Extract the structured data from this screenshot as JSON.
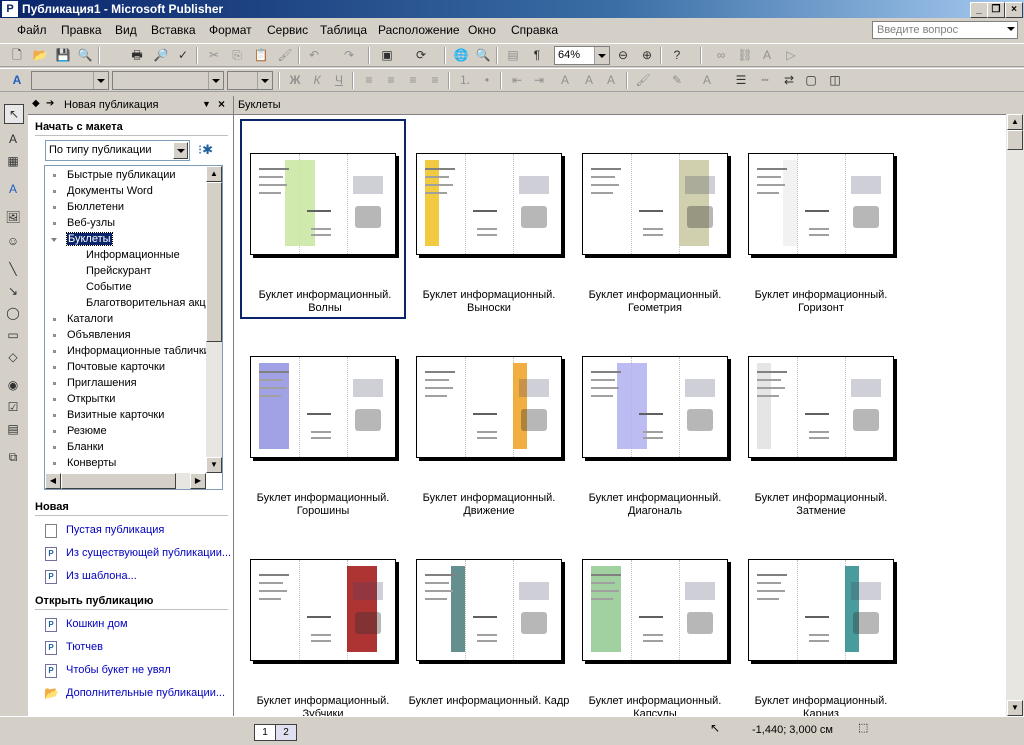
{
  "window": {
    "title": "Публикация1 - Microsoft Publisher",
    "app_icon": "publisher-icon"
  },
  "menu": [
    "Файл",
    "Правка",
    "Вид",
    "Вставка",
    "Формат",
    "Сервис",
    "Таблица",
    "Расположение",
    "Окно",
    "Справка"
  ],
  "ask_question": {
    "placeholder": "Введите вопрос"
  },
  "standard_toolbar": {
    "zoom": "64%"
  },
  "task_pane": {
    "title": "Новая публикация",
    "start_from_layout": "Начать с макета",
    "type_select": "По типу публикации",
    "tree": [
      {
        "label": "Быстрые публикации",
        "level": 0
      },
      {
        "label": "Документы Word",
        "level": 0
      },
      {
        "label": "Бюллетени",
        "level": 0
      },
      {
        "label": "Веб-узлы",
        "level": 0
      },
      {
        "label": "Буклеты",
        "level": 0,
        "expanded": true,
        "selected": true
      },
      {
        "label": "Информационные",
        "level": 1
      },
      {
        "label": "Прейскурант",
        "level": 1
      },
      {
        "label": "Событие",
        "level": 1
      },
      {
        "label": "Благотворительная акц",
        "level": 1
      },
      {
        "label": "Каталоги",
        "level": 0
      },
      {
        "label": "Объявления",
        "level": 0
      },
      {
        "label": "Информационные таблички",
        "level": 0
      },
      {
        "label": "Почтовые карточки",
        "level": 0
      },
      {
        "label": "Приглашения",
        "level": 0
      },
      {
        "label": "Открытки",
        "level": 0
      },
      {
        "label": "Визитные карточки",
        "level": 0
      },
      {
        "label": "Резюме",
        "level": 0
      },
      {
        "label": "Бланки",
        "level": 0
      },
      {
        "label": "Конверты",
        "level": 0
      }
    ],
    "new_section": "Новая",
    "new_links": [
      "Пустая публикация",
      "Из существующей публикации...",
      "Из шаблона..."
    ],
    "open_section": "Открыть публикацию",
    "open_links": [
      "Кошкин дом",
      "Тютчев",
      "Чтобы букет не увял",
      "Дополнительные публикации..."
    ]
  },
  "gallery": {
    "title": "Буклеты",
    "items": [
      {
        "l1": "Буклет информационный.",
        "l2": "Волны",
        "selected": true
      },
      {
        "l1": "Буклет информационный.",
        "l2": "Выноски"
      },
      {
        "l1": "Буклет информационный.",
        "l2": "Геометрия"
      },
      {
        "l1": "Буклет информационный.",
        "l2": "Горизонт"
      },
      {
        "l1": "Буклет информационный.",
        "l2": "Горошины"
      },
      {
        "l1": "Буклет информационный.",
        "l2": "Движение"
      },
      {
        "l1": "Буклет информационный.",
        "l2": "Диагональ"
      },
      {
        "l1": "Буклет информационный.",
        "l2": "Затмение"
      },
      {
        "l1": "Буклет информационный.",
        "l2": "Зубчики"
      },
      {
        "l1": "Буклет информационный. Кадр",
        "l2": ""
      },
      {
        "l1": "Буклет информационный.",
        "l2": "Капсулы"
      },
      {
        "l1": "Буклет информационный.",
        "l2": "Карниз"
      }
    ],
    "accents": [
      "#c8e6a0",
      "#f0c020",
      "#c8c8a0",
      "#f0f0f0",
      "#9090e0",
      "#f0a020",
      "#b0b0f0",
      "#e0e0e0",
      "#a01010",
      "#4a7a7a",
      "#90c890",
      "#2a8a8a"
    ]
  },
  "status": {
    "pages": [
      "1",
      "2"
    ],
    "coords": "-1,440; 3,000 см"
  }
}
